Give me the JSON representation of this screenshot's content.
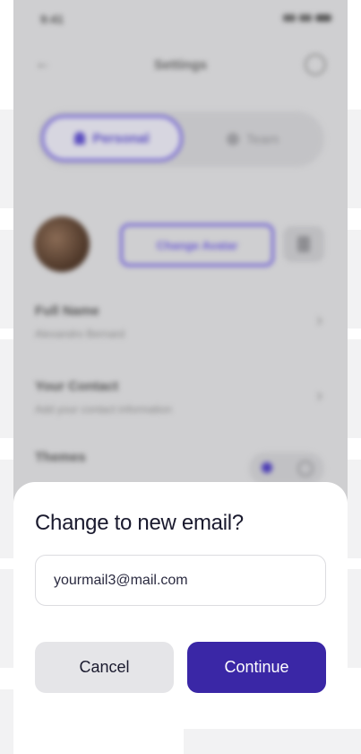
{
  "status_bar": {
    "time": "9:41"
  },
  "header": {
    "title": "Settings"
  },
  "segments": {
    "personal": "Personal",
    "team": "Team"
  },
  "profile": {
    "change_avatar_label": "Change Avatar"
  },
  "rows": [
    {
      "title": "Full Name",
      "subtitle": "Alexandro Bernard"
    },
    {
      "title": "Your Contact",
      "subtitle": "Add your contact information"
    },
    {
      "title": "Themes",
      "subtitle": ""
    }
  ],
  "dialog": {
    "title": "Change to new email?",
    "email_value": "yourmail3@mail.com",
    "cancel_label": "Cancel",
    "continue_label": "Continue"
  },
  "colors": {
    "accent": "#3a27a6",
    "cancel_bg": "#e5e5e8",
    "overlay": "#cfcfd1"
  }
}
